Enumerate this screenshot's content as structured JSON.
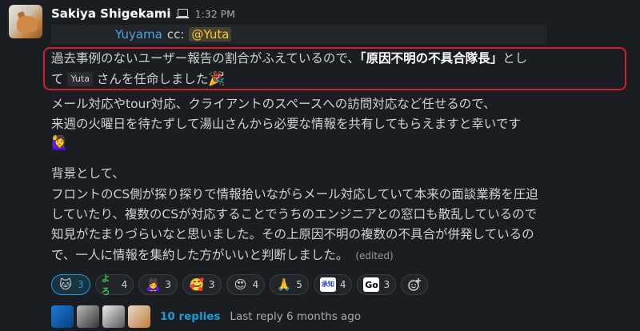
{
  "message": {
    "author": "Sakiya Shigekami",
    "time": "1:32 PM",
    "cc_line": {
      "mention_to": "Yuyama",
      "cc_label": "cc:",
      "mention_cc": "@Yuta"
    },
    "highlight_line1_prefix": "過去事例のないユーザー報告の割合がふえているので、",
    "highlight_line1_bold": "「原因不明の不具合隊長」",
    "highlight_line1_suffix": "とし",
    "highlight_line2_prefix": "て",
    "user_chip": "Yuta",
    "highlight_line2_suffix": "さんを任命しました",
    "body_lines": [
      "メール対応やtour対応、クライアントのスペースへの訪問対応など任せるので、",
      "来週の火曜日を待たずして湯山さんから必要な情報を共有してもらえますと幸いです"
    ],
    "background_heading": "背景として、",
    "background_lines": [
      "フロントのCS側が探り探りで情報拾いながらメール対応していて本来の面談業務を圧迫",
      "していたり、複数のCSが対応することでうちのエンジニアとの窓口も散乱しているので",
      "知見がたまりづらいなと思いました。その上原因不明の複数の不具合が併発しているの",
      "で、一人に情報を集約した方がいいと判断しました。"
    ],
    "edited": "(edited)"
  },
  "reactions": [
    {
      "emoji": "cool-cat-face",
      "glyph": "🐱",
      "count": "3",
      "active": true
    },
    {
      "emoji": "yoroshiku-text",
      "glyph": "よろ",
      "count": "4"
    },
    {
      "emoji": "woman-bowing",
      "glyph": "🙇‍♀️",
      "count": "3"
    },
    {
      "emoji": "smiling-face-with-hearts",
      "glyph": "🥰",
      "count": "3"
    },
    {
      "emoji": "heart-eyes",
      "glyph": "😍",
      "count": "4"
    },
    {
      "emoji": "folded-hands",
      "glyph": "🙏",
      "count": "5"
    },
    {
      "emoji": "text-stamp",
      "glyph": "承知",
      "count": "4"
    },
    {
      "emoji": "go-stamp",
      "glyph": "Go",
      "count": "3"
    }
  ],
  "thread": {
    "replies_label": "10 replies",
    "last_reply": "Last reply 6 months ago"
  }
}
